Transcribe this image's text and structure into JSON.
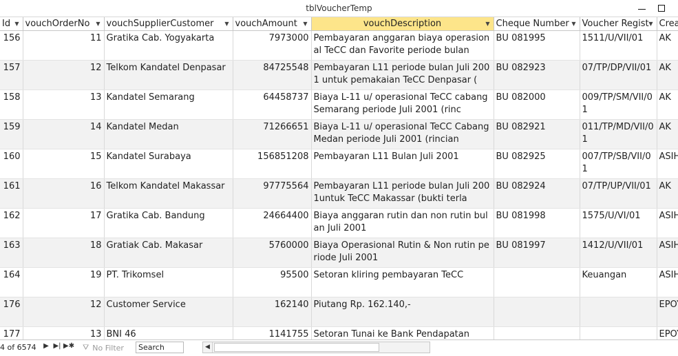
{
  "window": {
    "title": "tblVoucherTemp"
  },
  "columns": [
    "Id",
    "vouchOrderNo",
    "vouchSupplierCustomer",
    "vouchAmount",
    "vouchDescription",
    "Cheque Number",
    "Voucher Regist",
    "Crea"
  ],
  "rows": [
    [
      "156",
      "11",
      "Gratika Cab. Yogyakarta",
      "7973000",
      "Pembayaran anggaran biaya operasional TeCC dan Favorite periode bulan",
      "BU 081995",
      "1511/U/VII/01",
      "AK"
    ],
    [
      "157",
      "12",
      "Telkom Kandatel Denpasar",
      "84725548",
      "Pembayaran L11 periode bulan Juli 2001 untuk pemakaian TeCC Denpasar (",
      "BU 082923",
      "07/TP/DP/VII/01",
      "AK"
    ],
    [
      "158",
      "13",
      "Kandatel Semarang",
      "64458737",
      "Biaya L-11 u/ operasional TeCC cabang Semarang periode Juli 2001 (rinc",
      "BU 082000",
      "009/TP/SM/VII/01",
      "AK"
    ],
    [
      "159",
      "14",
      "Kandatel Medan",
      "71266651",
      "Biaya L-11 u/ operasional TeCC Cabang Medan periode Juli 2001 (rincian",
      "BU 082921",
      "011/TP/MD/VII/01",
      "AK"
    ],
    [
      "160",
      "15",
      "Kandatel Surabaya",
      "156851208",
      "Pembayaran L11 Bulan Juli 2001",
      "BU 082925",
      "007/TP/SB/VII/01",
      "ASIH"
    ],
    [
      "161",
      "16",
      "Telkom Kandatel Makassar",
      "97775564",
      "Pembayaran L11 periode bulan Juli 2001untuk TeCC Makassar (bukti terla",
      "BU 082924",
      "07/TP/UP/VII/01",
      "AK"
    ],
    [
      "162",
      "17",
      "Gratika Cab. Bandung",
      "24664400",
      "Biaya anggaran rutin dan non rutin bulan Juli 2001",
      "BU 081998",
      "1575/U/VI/01",
      "ASIH"
    ],
    [
      "163",
      "18",
      "Gratiak Cab. Makasar",
      "5760000",
      "Biaya Operasional Rutin & Non rutin periode Juli 2001",
      "BU 081997",
      "1412/U/VII/01",
      "ASIH"
    ],
    [
      "164",
      "19",
      "PT. Trikomsel",
      "95500",
      "Setoran kliring pembayaran TeCC",
      "",
      "Keuangan",
      "ASIH"
    ],
    [
      "176",
      "12",
      "Customer Service",
      "162140",
      "Piutang Rp. 162.140,-",
      "",
      "",
      "EPOY"
    ],
    [
      "177",
      "13",
      "BNI 46",
      "1141755",
      "Setoran Tunai ke Bank Pendapatan",
      "",
      "",
      "EPOY"
    ]
  ],
  "navigation": {
    "record_text": "4 of 6574",
    "no_filter_label": "No Filter",
    "search_label": "Search"
  },
  "colors": {
    "selected_header": "#fde58a",
    "alt_row": "#f2f2f2"
  }
}
